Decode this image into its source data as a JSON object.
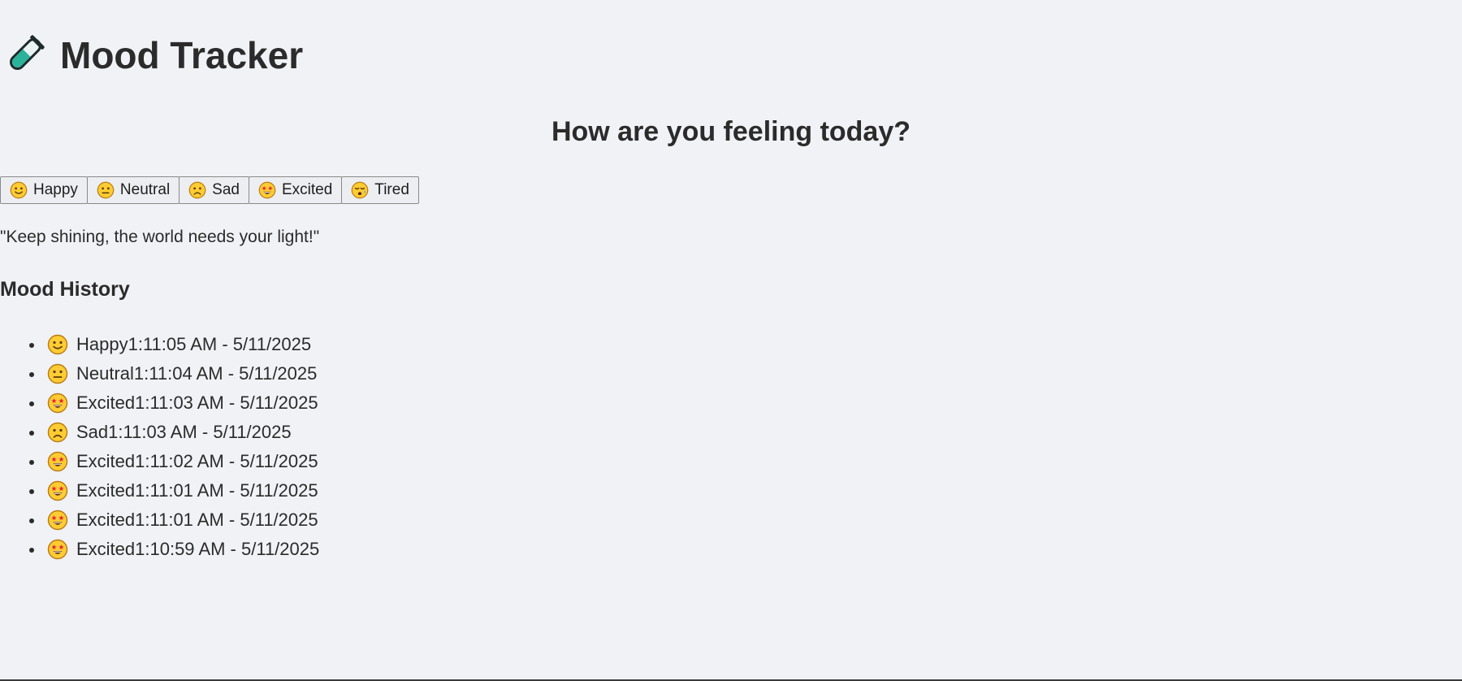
{
  "header": {
    "logo_icon": "test-tube-icon",
    "title": "Mood Tracker"
  },
  "prompt": {
    "question": "How are you feeling today?"
  },
  "moods": [
    {
      "label": "Happy",
      "icon": "slightly-smiling-face-icon"
    },
    {
      "label": "Neutral",
      "icon": "neutral-face-icon"
    },
    {
      "label": "Sad",
      "icon": "frowning-face-icon"
    },
    {
      "label": "Excited",
      "icon": "star-struck-face-icon"
    },
    {
      "label": "Tired",
      "icon": "sleepy-face-icon"
    }
  ],
  "quote": "\"Keep shining, the world needs your light!\"",
  "history": {
    "title": "Mood History",
    "entries": [
      {
        "text": "Happy1:11:05 AM - 5/11/2025",
        "icon": "slightly-smiling-face-icon"
      },
      {
        "text": "Neutral1:11:04 AM - 5/11/2025",
        "icon": "neutral-face-icon"
      },
      {
        "text": "Excited1:11:03 AM - 5/11/2025",
        "icon": "star-struck-face-icon"
      },
      {
        "text": "Sad1:11:03 AM - 5/11/2025",
        "icon": "frowning-face-icon"
      },
      {
        "text": "Excited1:11:02 AM - 5/11/2025",
        "icon": "star-struck-face-icon"
      },
      {
        "text": "Excited1:11:01 AM - 5/11/2025",
        "icon": "star-struck-face-icon"
      },
      {
        "text": "Excited1:11:01 AM - 5/11/2025",
        "icon": "star-struck-face-icon"
      },
      {
        "text": "Excited1:10:59 AM - 5/11/2025",
        "icon": "star-struck-face-icon"
      }
    ]
  },
  "colors": {
    "background": "#f0f2f6",
    "text": "#2b2b2b",
    "emoji_yellow": "#ffcc33",
    "emoji_outline": "#b97a10",
    "tube_teal": "#2bb39a"
  }
}
